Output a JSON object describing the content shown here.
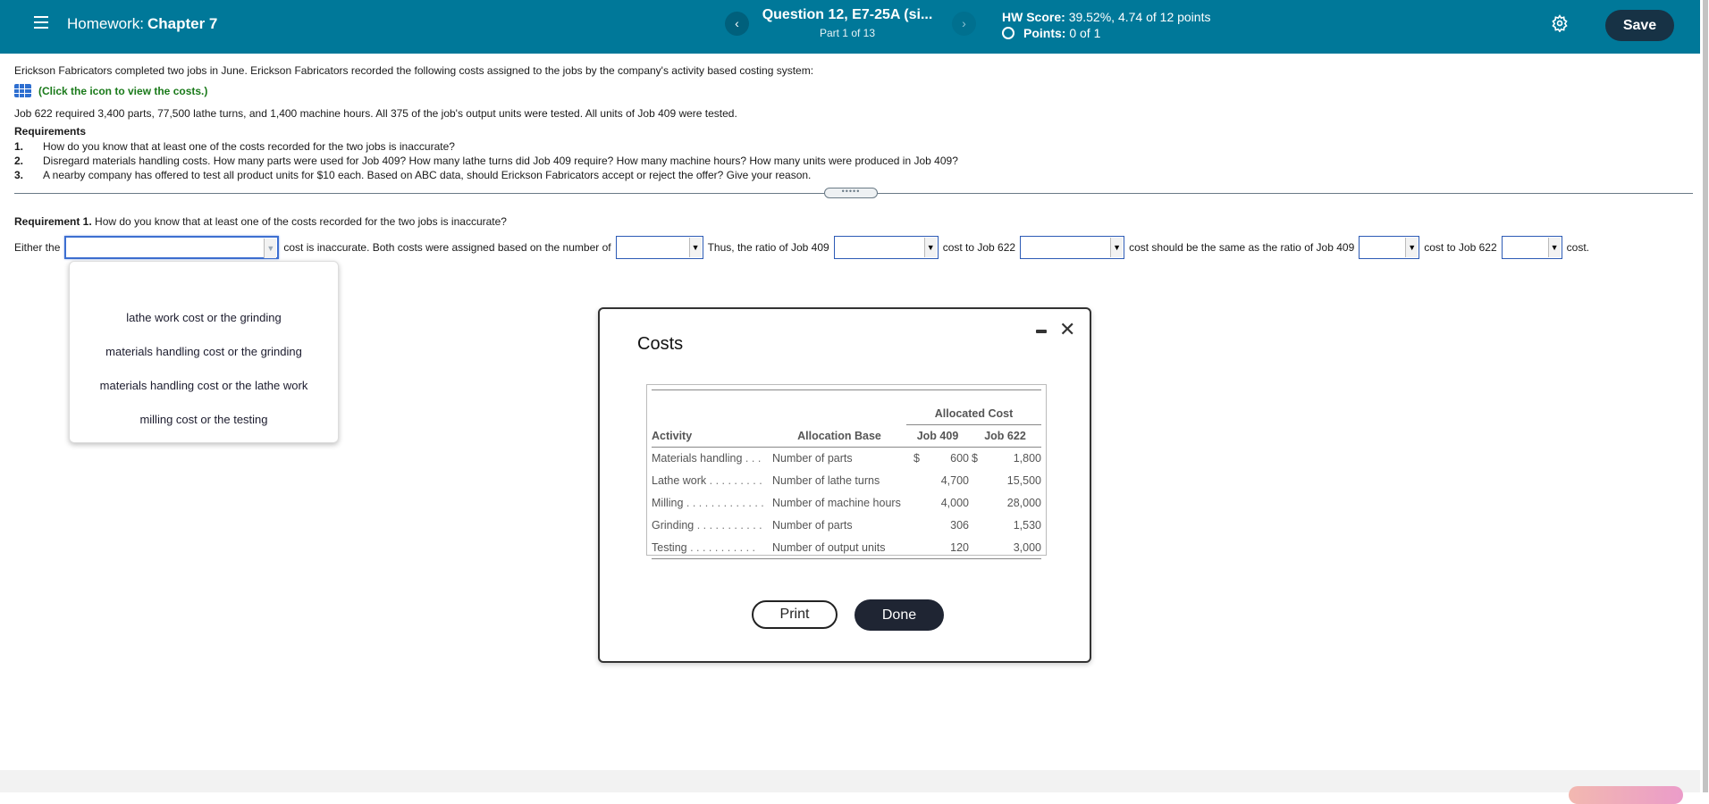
{
  "header": {
    "homework_label": "Homework:",
    "chapter": "Chapter 7",
    "question_title": "Question 12, E7-25A (si...",
    "part": "Part 1 of 13",
    "hw_score_label": "HW Score:",
    "hw_score_value": "39.52%, 4.74 of 12 points",
    "points_label": "Points:",
    "points_value": "0 of 1",
    "save_label": "Save",
    "prev_icon": "‹",
    "next_icon": "›",
    "brand_color": "#007899"
  },
  "problem": {
    "intro": "Erickson Fabricators completed two jobs in June. Erickson Fabricators recorded the following costs assigned to the jobs by the company's activity based costing system:",
    "costs_link": "(Click the icon to view the costs.)",
    "job_info": "Job 622 required 3,400 parts, 77,500 lathe turns, and 1,400 machine hours. All 375 of the job's output units were tested. All units of Job 409 were tested.",
    "requirements_title": "Requirements",
    "requirements": [
      {
        "num": "1.",
        "text": "How do you know that at least one of the costs recorded for the two jobs is inaccurate?"
      },
      {
        "num": "2.",
        "text": "Disregard materials handling costs. How many parts were used for Job 409? How many lathe turns did Job 409 require? How many machine hours? How many units were produced in Job 409?"
      },
      {
        "num": "3.",
        "text": "A nearby company has offered to test all product units for $10 each. Based on ABC data, should Erickson Fabricators accept or reject the offer? Give your reason."
      }
    ],
    "divider_handle": "•••••"
  },
  "requirement1": {
    "label": "Requirement 1.",
    "question": "How do you know that at least one of the costs recorded for the two jobs is inaccurate?",
    "sentence": {
      "t1": "Either the",
      "t2": "cost is inaccurate. Both costs were assigned based on the number of",
      "t3": "Thus, the ratio of Job 409",
      "t4": "cost to Job 622",
      "t5": "cost should be the same as the ratio of Job 409",
      "t6": "cost to Job 622",
      "t7": "cost."
    },
    "dropdowns": [
      {
        "selected": ""
      },
      {
        "selected": ""
      },
      {
        "selected": ""
      },
      {
        "selected": ""
      },
      {
        "selected": ""
      },
      {
        "selected": ""
      }
    ],
    "open_dropdown_options": [
      "lathe work cost or the grinding",
      "materials handling cost or the grinding",
      "materials handling cost or the lathe work",
      "milling cost or the testing"
    ]
  },
  "costs_modal": {
    "title": "Costs",
    "group_header": "Allocated Cost",
    "columns": [
      "Activity",
      "Allocation Base",
      "Job 409",
      "Job 622"
    ],
    "rows": [
      {
        "activity": "Materials handling",
        "dots": " . . .",
        "base": "Number of parts",
        "cur409": "$",
        "job409": "600",
        "cur622": "$",
        "job622": "1,800"
      },
      {
        "activity": "Lathe work",
        "dots": " . . . . . . . . .",
        "base": "Number of lathe turns",
        "cur409": "",
        "job409": "4,700",
        "cur622": "",
        "job622": "15,500"
      },
      {
        "activity": "Milling",
        "dots": " . . . . . . . . . . . . .",
        "base": "Number of machine hours",
        "cur409": "",
        "job409": "4,000",
        "cur622": "",
        "job622": "28,000"
      },
      {
        "activity": "Grinding",
        "dots": " . . . . . . . . . . .",
        "base": "Number of parts",
        "cur409": "",
        "job409": "306",
        "cur622": "",
        "job622": "1,530"
      },
      {
        "activity": "Testing",
        "dots": " . . . . . . . . . . .",
        "base": "Number of output units",
        "cur409": "",
        "job409": "120",
        "cur622": "",
        "job622": "3,000"
      }
    ],
    "print_label": "Print",
    "done_label": "Done",
    "close_icon": "✕"
  }
}
